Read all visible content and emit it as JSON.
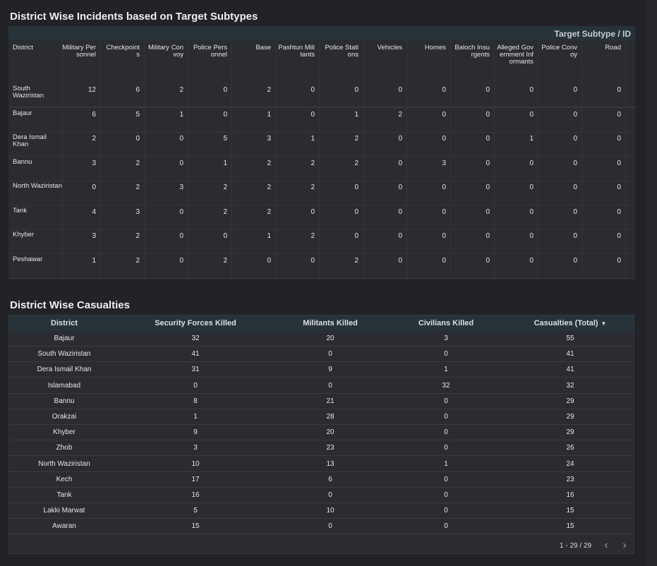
{
  "pivot": {
    "title": "District Wise Incidents based on Target Subtypes",
    "group_header": "Target Subtype / ID",
    "row_header": "District",
    "columns": [
      "Military Personnel",
      "Checkpoints",
      "Military Convoy",
      "Police Personnel",
      "Base",
      "Pashtun Militants",
      "Police Stations",
      "Vehicles",
      "Homes",
      "Baloch Insurgents",
      "Alleged Government Informants",
      "Police Convoy",
      "Road"
    ],
    "rows": [
      {
        "district": "South Waziristan",
        "values": [
          "12",
          "6",
          "2",
          "0",
          "2",
          "0",
          "0",
          "0",
          "0",
          "0",
          "0",
          "0",
          "0"
        ]
      },
      {
        "district": "Bajaur",
        "values": [
          "6",
          "5",
          "1",
          "0",
          "1",
          "0",
          "1",
          "2",
          "0",
          "0",
          "0",
          "0",
          "0"
        ]
      },
      {
        "district": "Dera Ismail Khan",
        "values": [
          "2",
          "0",
          "0",
          "5",
          "3",
          "1",
          "2",
          "0",
          "0",
          "0",
          "1",
          "0",
          "0"
        ]
      },
      {
        "district": "Bannu",
        "values": [
          "3",
          "2",
          "0",
          "1",
          "2",
          "2",
          "2",
          "0",
          "3",
          "0",
          "0",
          "0",
          "0"
        ]
      },
      {
        "district": "North Waziristan",
        "values": [
          "0",
          "2",
          "3",
          "2",
          "2",
          "2",
          "0",
          "0",
          "0",
          "0",
          "0",
          "0",
          "0"
        ]
      },
      {
        "district": "Tank",
        "values": [
          "4",
          "3",
          "0",
          "2",
          "2",
          "0",
          "0",
          "0",
          "0",
          "0",
          "0",
          "0",
          "0"
        ]
      },
      {
        "district": "Khyber",
        "values": [
          "3",
          "2",
          "0",
          "0",
          "1",
          "2",
          "0",
          "0",
          "0",
          "0",
          "0",
          "0",
          "0"
        ]
      },
      {
        "district": "Peshawar",
        "values": [
          "1",
          "2",
          "0",
          "2",
          "0",
          "0",
          "2",
          "0",
          "0",
          "0",
          "0",
          "0",
          "0"
        ]
      }
    ]
  },
  "casualties": {
    "title": "District Wise Casualties",
    "columns": [
      "District",
      "Security Forces Killed",
      "Militants Killed",
      "Civilians Killed",
      "Casualties (Total)"
    ],
    "sort_icon": "caret-down-icon",
    "rows": [
      [
        "Bajaur",
        "32",
        "20",
        "3",
        "55"
      ],
      [
        "South Waziristan",
        "41",
        "0",
        "0",
        "41"
      ],
      [
        "Dera Ismail Khan",
        "31",
        "9",
        "1",
        "41"
      ],
      [
        "Islamabad",
        "0",
        "0",
        "32",
        "32"
      ],
      [
        "Bannu",
        "8",
        "21",
        "0",
        "29"
      ],
      [
        "Orakzai",
        "1",
        "28",
        "0",
        "29"
      ],
      [
        "Khyber",
        "9",
        "20",
        "0",
        "29"
      ],
      [
        "Zhob",
        "3",
        "23",
        "0",
        "26"
      ],
      [
        "North Waziristan",
        "10",
        "13",
        "1",
        "24"
      ],
      [
        "Kech",
        "17",
        "6",
        "0",
        "23"
      ],
      [
        "Tank",
        "16",
        "0",
        "0",
        "16"
      ],
      [
        "Lakki Marwat",
        "5",
        "10",
        "0",
        "15"
      ],
      [
        "Awaran",
        "15",
        "0",
        "0",
        "15"
      ]
    ],
    "pagination": "1 - 29 / 29",
    "prev_icon": "chevron-left-icon",
    "next_icon": "chevron-right-icon"
  },
  "colors": {
    "background": "#222327",
    "panel": "#2b2c31",
    "header_band": "#26343a",
    "text": "#e6e6e6"
  }
}
